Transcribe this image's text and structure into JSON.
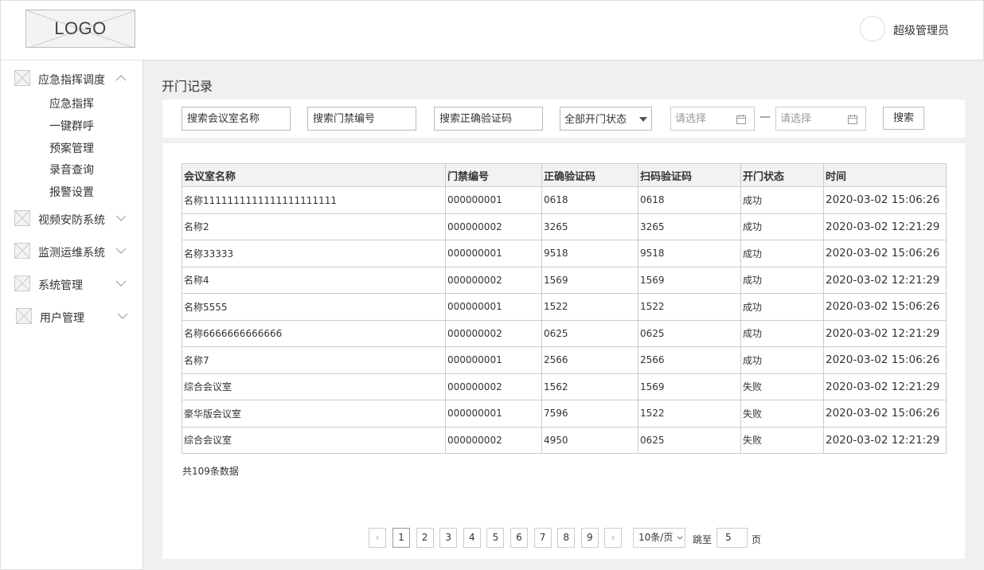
{
  "header": {
    "logo_text": "LOGO",
    "username": "超级管理员"
  },
  "sidebar": {
    "groups": [
      {
        "label": "应急指挥调度",
        "expanded": true
      },
      {
        "label": "视频安防系统",
        "expanded": false
      },
      {
        "label": "监测运维系统",
        "expanded": false
      },
      {
        "label": "系统管理",
        "expanded": false
      },
      {
        "label": "用户管理",
        "expanded": false
      }
    ],
    "subitems": [
      "应急指挥",
      "一键群呼",
      "预案管理",
      "录音查询",
      "报警设置"
    ]
  },
  "main": {
    "title": "开门记录",
    "filters": {
      "room_placeholder": "搜索会议室名称",
      "door_placeholder": "搜索门禁编号",
      "code_placeholder": "搜索正确验证码",
      "status_value": "全部开门状态",
      "date_start_placeholder": "请选择",
      "date_end_placeholder": "请选择",
      "date_separator": "—",
      "search_label": "搜索"
    },
    "table": {
      "headers": [
        "会议室名称",
        "门禁编号",
        "正确验证码",
        "扫码验证码",
        "开门状态",
        "时间"
      ],
      "rows": [
        [
          "名称1111111111111111111111",
          "000000001",
          "0618",
          "0618",
          "成功",
          "2020-03-02 15:06:26"
        ],
        [
          "名称2",
          "000000002",
          "3265",
          "3265",
          "成功",
          "2020-03-02 12:21:29"
        ],
        [
          "名称33333",
          "000000001",
          "9518",
          "9518",
          "成功",
          "2020-03-02 15:06:26"
        ],
        [
          "名称4",
          "000000002",
          "1569",
          "1569",
          "成功",
          "2020-03-02 12:21:29"
        ],
        [
          "名称5555",
          "000000001",
          "1522",
          "1522",
          "成功",
          "2020-03-02 15:06:26"
        ],
        [
          "名称6666666666666",
          "000000002",
          "0625",
          "0625",
          "成功",
          "2020-03-02 12:21:29"
        ],
        [
          "名称7",
          "000000001",
          "2566",
          "2566",
          "成功",
          "2020-03-02 15:06:26"
        ],
        [
          "综合会议室",
          "000000002",
          "1562",
          "1569",
          "失败",
          "2020-03-02 12:21:29"
        ],
        [
          "豪华版会议室",
          "000000001",
          "7596",
          "1522",
          "失败",
          "2020-03-02 15:06:26"
        ],
        [
          "综合会议室",
          "000000002",
          "4950",
          "0625",
          "失败",
          "2020-03-02 12:21:29"
        ]
      ]
    },
    "total_text": "共109条数据",
    "pagination": {
      "prev": "‹",
      "next": "›",
      "pages": [
        "1",
        "2",
        "3",
        "4",
        "5",
        "6",
        "7",
        "8",
        "9"
      ],
      "current": "1",
      "page_size": "10条/页",
      "jump_label": "跳至",
      "jump_value": "5",
      "jump_suffix": "页"
    }
  }
}
